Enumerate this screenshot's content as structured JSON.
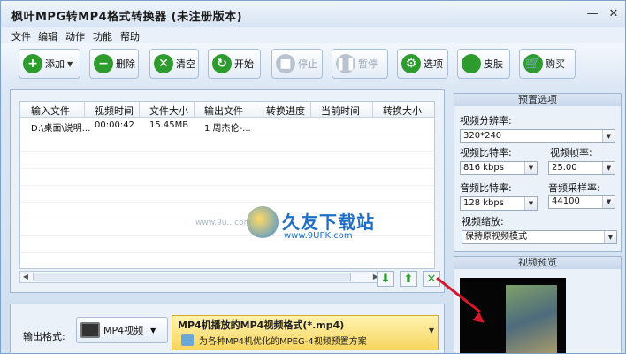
{
  "window": {
    "title": "枫叶MPG转MP4格式转换器  (未注册版本)"
  },
  "menu": [
    "文件",
    "编辑",
    "动作",
    "功能",
    "帮助"
  ],
  "toolbar": {
    "add": "添加",
    "delete": "删除",
    "clear": "清空",
    "start": "开始",
    "stop": "停止",
    "pause": "暂停",
    "options": "选项",
    "skin": "皮肤",
    "buy": "购买"
  },
  "table": {
    "headers": [
      "输入文件",
      "视频时间",
      "文件大小",
      "输出文件",
      "转换进度",
      "当前时间",
      "转换大小"
    ],
    "rows": [
      [
        "D:\\桌面\\说明...",
        "00:00:42",
        "15.45MB",
        "1 周杰伦-...",
        "",
        "",
        ""
      ]
    ]
  },
  "watermark": {
    "brand": "久友下载站",
    "url": "www.9UPK.com",
    "left": "www.9u...com"
  },
  "presets": {
    "title": "预置选项",
    "resolution_label": "视频分辨率:",
    "resolution_value": "320*240",
    "vbitrate_label": "视频比特率:",
    "vbitrate_value": "816 kbps",
    "framerate_label": "视频帧率:",
    "framerate_value": "25.00",
    "abitrate_label": "音频比特率:",
    "abitrate_value": "128 kbps",
    "samplerate_label": "音频采样率:",
    "samplerate_value": "44100",
    "scale_label": "视频缩放:",
    "scale_value": "保持原视频模式"
  },
  "preview": {
    "title": "视频预览"
  },
  "output": {
    "label": "输出格式:",
    "format_button": "MP4视频",
    "format_title": "MP4机播放的MP4视频格式(*.mp4)",
    "format_desc": "为各种MP4机优化的MPEG-4视频预置方案"
  }
}
